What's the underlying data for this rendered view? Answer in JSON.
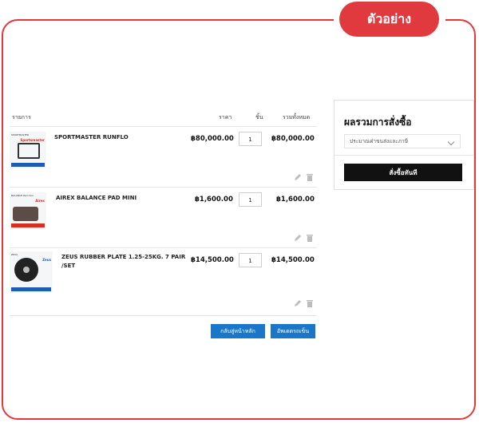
{
  "badge": {
    "label": "ตัวอย่าง"
  },
  "colors": {
    "accent": "#e03a3e",
    "button_blue": "#1976c9",
    "checkout_black": "#111111"
  },
  "cart": {
    "headers": {
      "item": "รายการ",
      "price": "ราคา",
      "qty": "ชิ้น",
      "total": "รวมทั้งหมด"
    },
    "items": [
      {
        "name": "SPORTMASTER RUNFLO",
        "price": "฿80,000.00",
        "qty": "1",
        "total": "฿80,000.00",
        "thumb_top": "SPORTMASTER",
        "thumb_brand": "Sportsmaster"
      },
      {
        "name": "AIREX BALANCE PAD MINI",
        "price": "฿1,600.00",
        "qty": "1",
        "total": "฿1,600.00",
        "thumb_top": "BALANCE Pad mini",
        "thumb_brand": "Airex"
      },
      {
        "name_line1": "ZEUS RUBBER PLATE 1.25-25KG. 7 PAIR",
        "name_line2": "/SET",
        "price": "฿14,500.00",
        "qty": "1",
        "total": "฿14,500.00",
        "thumb_top": "ZEUS",
        "thumb_brand": "Zeus"
      }
    ],
    "buttons": {
      "back": "กลับสู่หน้าหลัก",
      "update": "อัพเดตรถเข็น"
    }
  },
  "summary": {
    "title": "ผลรวมการสั่งซื้อ",
    "select_value": "ประมาณค่าขนส่งและภาษี",
    "checkout": "สั่งซื้อทันที"
  },
  "icons": {
    "edit": "pencil-icon",
    "delete": "trash-icon",
    "dropdown": "chevron-down-icon"
  }
}
